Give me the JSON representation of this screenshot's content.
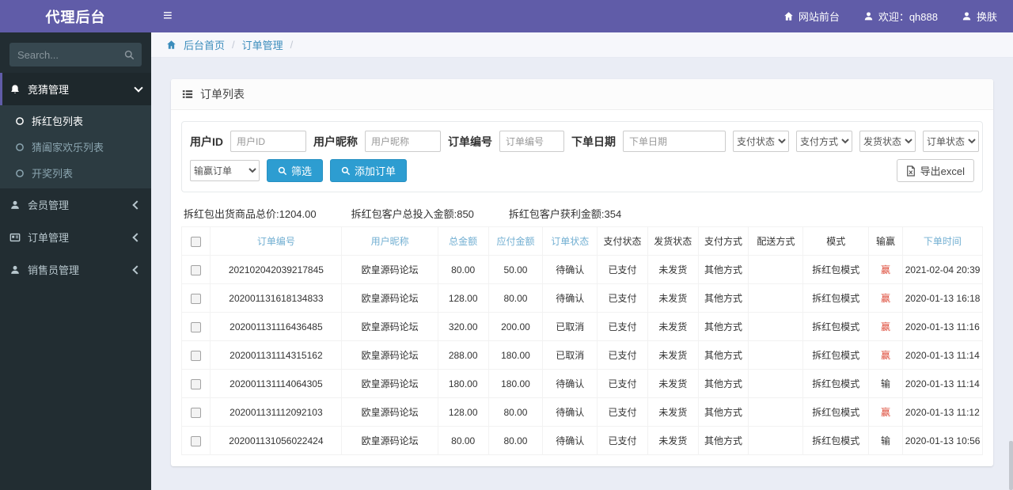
{
  "app": {
    "brand": "代理后台"
  },
  "navbar": {
    "site_front": "网站前台",
    "welcome": "欢迎：qh888",
    "change_skin": "换肤"
  },
  "sidebar": {
    "search_placeholder": "Search...",
    "menu": [
      {
        "label": "竞猜管理",
        "icon": "bell-icon",
        "children": [
          "拆红包列表",
          "猜阖家欢乐列表",
          "开奖列表"
        ]
      },
      {
        "label": "会员管理",
        "icon": "user-icon"
      },
      {
        "label": "订单管理",
        "icon": "card-icon"
      },
      {
        "label": "销售员管理",
        "icon": "user-icon"
      }
    ]
  },
  "breadcrumb": {
    "home": "后台首页",
    "current": "订单管理",
    "separator": "/"
  },
  "panel": {
    "title": "订单列表"
  },
  "filters": {
    "user_id_label": "用户ID",
    "user_id_placeholder": "用户ID",
    "nickname_label": "用户昵称",
    "nickname_placeholder": "用户昵称",
    "order_no_label": "订单编号",
    "order_no_placeholder": "订单编号",
    "order_date_label": "下单日期",
    "order_date_placeholder": "下单日期",
    "selects": [
      "支付状态",
      "支付方式",
      "发货状态",
      "订单状态"
    ],
    "winlose_select": "输赢订单",
    "filter_button": "筛选",
    "add_button": "添加订单",
    "export_button": "导出excel"
  },
  "summary": [
    "拆红包出货商品总价:1204.00",
    "拆红包客户总投入金额:850",
    "拆红包客户获利金额:354"
  ],
  "table": {
    "headers": [
      {
        "label": "订单编号",
        "link": true
      },
      {
        "label": "用户昵称",
        "link": true
      },
      {
        "label": "总金额",
        "link": true
      },
      {
        "label": "应付金额",
        "link": true
      },
      {
        "label": "订单状态",
        "link": true
      },
      {
        "label": "支付状态",
        "link": false
      },
      {
        "label": "发货状态",
        "link": false
      },
      {
        "label": "支付方式",
        "link": false
      },
      {
        "label": "配送方式",
        "link": false
      },
      {
        "label": "模式",
        "link": false
      },
      {
        "label": "输赢",
        "link": false
      },
      {
        "label": "下单时间",
        "link": true
      }
    ],
    "rows": [
      {
        "order_no": "202102042039217845",
        "nickname": "欧皇源码论坛",
        "total": "80.00",
        "payable": "50.00",
        "order_status": "待确认",
        "pay_status": "已支付",
        "ship_status": "未发货",
        "pay_method": "其他方式",
        "delivery": "",
        "mode": "拆红包模式",
        "winlose": "赢",
        "win": true,
        "time": "2021-02-04 20:39"
      },
      {
        "order_no": "202001131618134833",
        "nickname": "欧皇源码论坛",
        "total": "128.00",
        "payable": "80.00",
        "order_status": "待确认",
        "pay_status": "已支付",
        "ship_status": "未发货",
        "pay_method": "其他方式",
        "delivery": "",
        "mode": "拆红包模式",
        "winlose": "赢",
        "win": true,
        "time": "2020-01-13 16:18"
      },
      {
        "order_no": "202001131116436485",
        "nickname": "欧皇源码论坛",
        "total": "320.00",
        "payable": "200.00",
        "order_status": "已取消",
        "pay_status": "已支付",
        "ship_status": "未发货",
        "pay_method": "其他方式",
        "delivery": "",
        "mode": "拆红包模式",
        "winlose": "赢",
        "win": true,
        "time": "2020-01-13 11:16"
      },
      {
        "order_no": "202001131114315162",
        "nickname": "欧皇源码论坛",
        "total": "288.00",
        "payable": "180.00",
        "order_status": "已取消",
        "pay_status": "已支付",
        "ship_status": "未发货",
        "pay_method": "其他方式",
        "delivery": "",
        "mode": "拆红包模式",
        "winlose": "赢",
        "win": true,
        "time": "2020-01-13 11:14"
      },
      {
        "order_no": "202001131114064305",
        "nickname": "欧皇源码论坛",
        "total": "180.00",
        "payable": "180.00",
        "order_status": "待确认",
        "pay_status": "已支付",
        "ship_status": "未发货",
        "pay_method": "其他方式",
        "delivery": "",
        "mode": "拆红包模式",
        "winlose": "输",
        "win": false,
        "time": "2020-01-13 11:14"
      },
      {
        "order_no": "202001131112092103",
        "nickname": "欧皇源码论坛",
        "total": "128.00",
        "payable": "80.00",
        "order_status": "待确认",
        "pay_status": "已支付",
        "ship_status": "未发货",
        "pay_method": "其他方式",
        "delivery": "",
        "mode": "拆红包模式",
        "winlose": "赢",
        "win": true,
        "time": "2020-01-13 11:12"
      },
      {
        "order_no": "202001131056022424",
        "nickname": "欧皇源码论坛",
        "total": "80.00",
        "payable": "80.00",
        "order_status": "待确认",
        "pay_status": "已支付",
        "ship_status": "未发货",
        "pay_method": "其他方式",
        "delivery": "",
        "mode": "拆红包模式",
        "winlose": "输",
        "win": false,
        "time": "2020-01-13 10:56"
      }
    ]
  },
  "colors": {
    "brand_purple": "#605ca8",
    "sidebar_dark": "#222d32",
    "link_blue": "#3c8dbc",
    "header_link_blue": "#72afd2",
    "button_blue": "#2d9dd1",
    "win_red": "#dd4b39"
  }
}
